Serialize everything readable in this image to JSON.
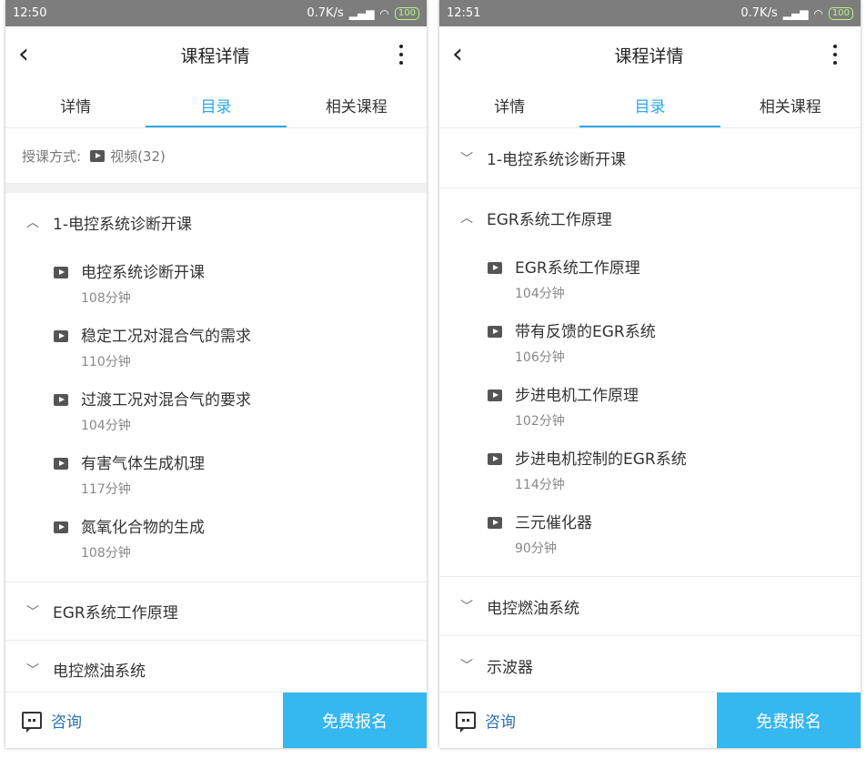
{
  "screens": [
    {
      "status": {
        "time": "12:50",
        "net": "0.7K/s",
        "battery": "100"
      },
      "header": {
        "title": "课程详情"
      },
      "tabs": [
        "详情",
        "目录",
        "相关课程"
      ],
      "mode": {
        "label": "授课方式:",
        "value": "视频(32)"
      },
      "chapters": [
        {
          "title": "1-电控系统诊断开课",
          "expanded": true,
          "lessons": [
            {
              "title": "电控系统诊断开课",
              "duration": "108分钟"
            },
            {
              "title": "稳定工况对混合气的需求",
              "duration": "110分钟"
            },
            {
              "title": "过渡工况对混合气的要求",
              "duration": "104分钟"
            },
            {
              "title": "有害气体生成机理",
              "duration": "117分钟"
            },
            {
              "title": "氮氧化合物的生成",
              "duration": "108分钟"
            }
          ]
        },
        {
          "title": "EGR系统工作原理",
          "expanded": false
        },
        {
          "title": "电控燃油系统",
          "expanded": false
        }
      ],
      "footer": {
        "consult": "咨询",
        "enroll": "免费报名"
      }
    },
    {
      "status": {
        "time": "12:51",
        "net": "0.7K/s",
        "battery": "100"
      },
      "header": {
        "title": "课程详情"
      },
      "tabs": [
        "详情",
        "目录",
        "相关课程"
      ],
      "chapters": [
        {
          "title": "1-电控系统诊断开课",
          "expanded": false
        },
        {
          "title": "EGR系统工作原理",
          "expanded": true,
          "lessons": [
            {
              "title": "EGR系统工作原理",
              "duration": "104分钟"
            },
            {
              "title": "带有反馈的EGR系统",
              "duration": "106分钟"
            },
            {
              "title": "步进电机工作原理",
              "duration": "102分钟"
            },
            {
              "title": "步进电机控制的EGR系统",
              "duration": "114分钟"
            },
            {
              "title": "三元催化器",
              "duration": "90分钟"
            }
          ]
        },
        {
          "title": "电控燃油系统",
          "expanded": false
        },
        {
          "title": "示波器",
          "expanded": false
        }
      ],
      "footer": {
        "consult": "咨询",
        "enroll": "免费报名"
      }
    }
  ],
  "icons": {
    "back": "back-arrow-icon",
    "more": "more-vertical-icon",
    "play": "video-play-icon",
    "chat": "chat-bubble-icon",
    "expand": "chevron-down-icon",
    "collapse": "chevron-up-icon"
  },
  "colors": {
    "accent": "#2aa9e8",
    "enroll_bg": "#35b7f0",
    "status_bar": "#7d7d7d",
    "consult_text": "#2a6fb0"
  }
}
